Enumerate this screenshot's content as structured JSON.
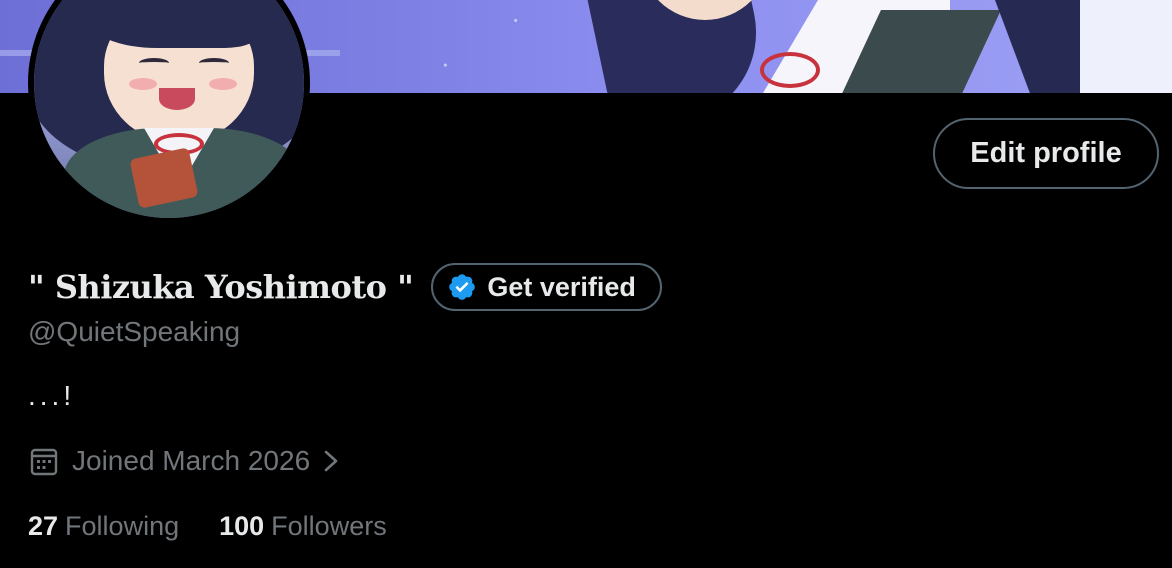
{
  "profile": {
    "display_name": "\" Shizuka Yoshimoto \"",
    "verify_label": "Get verified",
    "handle": "@QuietSpeaking",
    "bio": "...!",
    "joined": "Joined March 2026",
    "edit_profile_label": "Edit profile"
  },
  "stats": {
    "following_count": "27",
    "following_label": "Following",
    "followers_count": "100",
    "followers_label": "Followers"
  },
  "icons": {
    "verified_badge": "verified-badge-icon",
    "calendar": "calendar-icon",
    "chevron": "chevron-right-icon"
  },
  "colors": {
    "background": "#000000",
    "primary_text": "#e7e9ea",
    "secondary_text": "#71767b",
    "border": "#536471",
    "verified_blue": "#1d9bf0"
  }
}
